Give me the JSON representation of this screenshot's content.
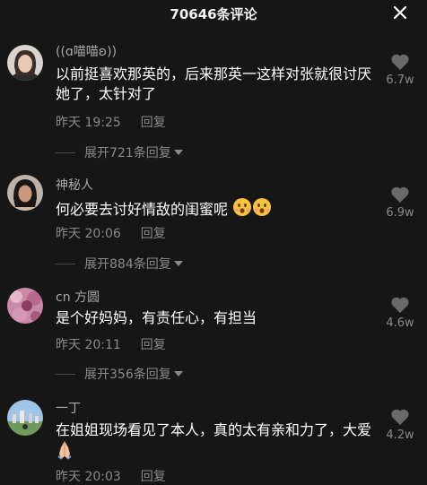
{
  "header": {
    "title": "70646条评论",
    "close_icon": "close-icon"
  },
  "comments": [
    {
      "user": "((ɑ喵喵ʚ))",
      "text": "以前挺喜欢那英的，后来那英一这样对张就很讨厌她了，太针对了",
      "time": "昨天 19:25",
      "reply": "回复",
      "expand": "展开721条回复",
      "likes": "6.7w"
    },
    {
      "user": "神秘人",
      "text": "何必要去讨好情敌的闺蜜呢",
      "emoji": "hushed-face-emoji ×2",
      "time": "昨天 20:06",
      "reply": "回复",
      "expand": "展开884条回复",
      "likes": "6.9w"
    },
    {
      "user": "cn 方圆",
      "text": "是个好妈妈，有责任心，有担当",
      "time": "昨天 20:11",
      "reply": "回复",
      "expand": "展开356条回复",
      "likes": "4.6w"
    },
    {
      "user": "一丁",
      "text": "在姐姐现场看见了本人，真的太有亲和力了，大爱",
      "emoji": "pray-hands-emoji",
      "time": "昨天 20:03",
      "reply": "回复",
      "likes": "4.2w"
    }
  ],
  "colors": {
    "background": "#161616",
    "secondary_text": "#8a8a8a",
    "heart_icon": "#6a6a6a"
  }
}
